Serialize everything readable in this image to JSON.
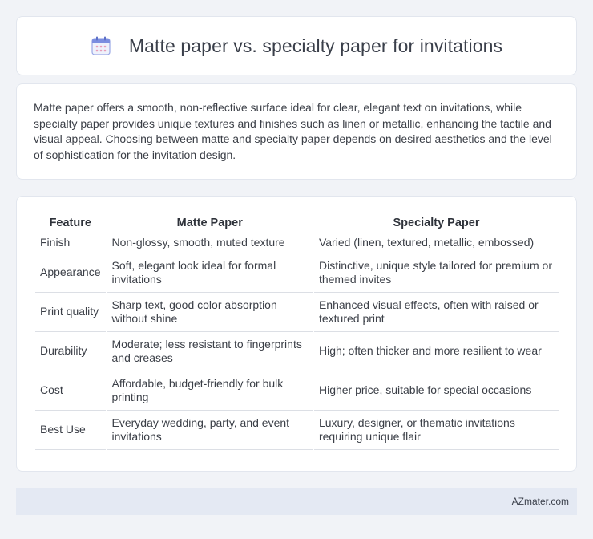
{
  "header": {
    "title": "Matte paper vs. specialty paper for invitations",
    "icon": "calendar-icon"
  },
  "intro": {
    "text": "Matte paper offers a smooth, non-reflective surface ideal for clear, elegant text on invitations, while specialty paper provides unique textures and finishes such as linen or metallic, enhancing the tactile and visual appeal. Choosing between matte and specialty paper depends on desired aesthetics and the level of sophistication for the invitation design."
  },
  "table": {
    "headers": [
      "Feature",
      "Matte Paper",
      "Specialty Paper"
    ],
    "rows": [
      [
        "Finish",
        "Non-glossy, smooth, muted texture",
        "Varied (linen, textured, metallic, embossed)"
      ],
      [
        "Appearance",
        "Soft, elegant look ideal for formal invitations",
        "Distinctive, unique style tailored for premium or themed invites"
      ],
      [
        "Print quality",
        "Sharp text, good color absorption without shine",
        "Enhanced visual effects, often with raised or textured print"
      ],
      [
        "Durability",
        "Moderate; less resistant to fingerprints and creases",
        "High; often thicker and more resilient to wear"
      ],
      [
        "Cost",
        "Affordable, budget-friendly for bulk printing",
        "Higher price, suitable for special occasions"
      ],
      [
        "Best Use",
        "Everyday wedding, party, and event invitations",
        "Luxury, designer, or thematic invitations requiring unique flair"
      ]
    ]
  },
  "footer": {
    "brand": "AZmater.com"
  },
  "colors": {
    "background": "#f1f3f7",
    "card": "#ffffff",
    "footer": "#e4e9f3",
    "icon_accent": "#7b8ee0"
  }
}
